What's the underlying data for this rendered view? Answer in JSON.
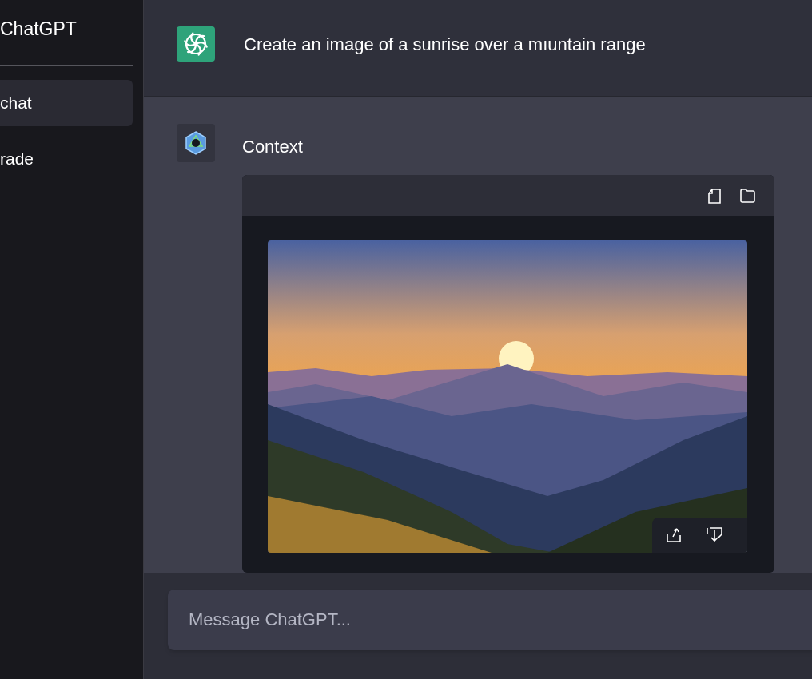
{
  "sidebar": {
    "title": "ChatGPT",
    "items": [
      {
        "label": "chat",
        "selected": true
      },
      {
        "label": "rade",
        "selected": false
      }
    ]
  },
  "messages": [
    {
      "kind": "user",
      "text": "Create an image of a sunrise over a mıuntain range"
    },
    {
      "kind": "assistant",
      "text": "Context"
    }
  ],
  "composer": {
    "placeholder": "Message ChatGPT..."
  }
}
